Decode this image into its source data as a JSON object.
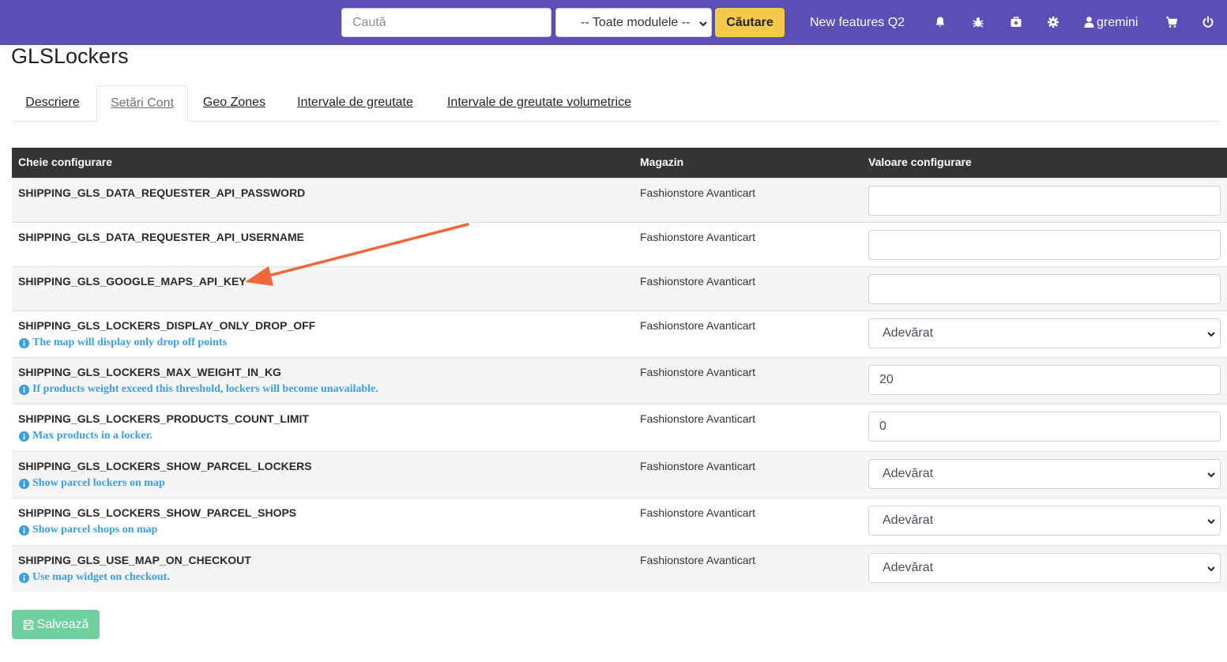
{
  "navbar": {
    "search_placeholder": "Caută",
    "module_select_value": "-- Toate modulele --",
    "search_button": "Căutare",
    "new_features": "New features Q2",
    "username": "gremini",
    "background_color": "#5b4fb6",
    "icons": [
      "bell-icon",
      "bug-icon",
      "medkit-icon",
      "gear-icon",
      "user-icon",
      "cart-icon",
      "power-icon"
    ]
  },
  "page": {
    "title": "GLSLockers"
  },
  "tabs": [
    {
      "label": "Descriere",
      "active": false
    },
    {
      "label": "Setări Cont",
      "active": true
    },
    {
      "label": "Geo Zones",
      "active": false
    },
    {
      "label": "Intervale de greutate",
      "active": false
    },
    {
      "label": "Intervale de greutate volumetrice",
      "active": false
    }
  ],
  "table": {
    "headers": {
      "key": "Cheie configurare",
      "store": "Magazin",
      "value": "Valoare configurare"
    },
    "rows": [
      {
        "key": "SHIPPING_GLS_DATA_REQUESTER_API_PASSWORD",
        "help": "",
        "store": "Fashionstore Avanticart",
        "type": "text",
        "value": ""
      },
      {
        "key": "SHIPPING_GLS_DATA_REQUESTER_API_USERNAME",
        "help": "",
        "store": "Fashionstore Avanticart",
        "type": "text",
        "value": ""
      },
      {
        "key": "SHIPPING_GLS_GOOGLE_MAPS_API_KEY",
        "help": "",
        "store": "Fashionstore Avanticart",
        "type": "text",
        "value": ""
      },
      {
        "key": "SHIPPING_GLS_LOCKERS_DISPLAY_ONLY_DROP_OFF",
        "help": "The map will display only drop off points",
        "store": "Fashionstore Avanticart",
        "type": "select",
        "value": "Adevărat"
      },
      {
        "key": "SHIPPING_GLS_LOCKERS_MAX_WEIGHT_IN_KG",
        "help": "If products weight exceed this threshold, lockers will become unavailable.",
        "store": "Fashionstore Avanticart",
        "type": "text",
        "value": "20"
      },
      {
        "key": "SHIPPING_GLS_LOCKERS_PRODUCTS_COUNT_LIMIT",
        "help": "Max products in a locker.",
        "store": "Fashionstore Avanticart",
        "type": "text",
        "value": "0"
      },
      {
        "key": "SHIPPING_GLS_LOCKERS_SHOW_PARCEL_LOCKERS",
        "help": "Show parcel lockers on map",
        "store": "Fashionstore Avanticart",
        "type": "select",
        "value": "Adevărat"
      },
      {
        "key": "SHIPPING_GLS_LOCKERS_SHOW_PARCEL_SHOPS",
        "help": "Show parcel shops on map",
        "store": "Fashionstore Avanticart",
        "type": "select",
        "value": "Adevărat"
      },
      {
        "key": "SHIPPING_GLS_USE_MAP_ON_CHECKOUT",
        "help": "Use map widget on checkout.",
        "store": "Fashionstore Avanticart",
        "type": "select",
        "value": "Adevărat"
      }
    ]
  },
  "save_button": {
    "label": "Salvează",
    "color": "#6fcf9f"
  },
  "annotation": {
    "arrow_color": "#f0683a",
    "points_to": "SHIPPING_GLS_GOOGLE_MAPS_API_KEY"
  }
}
